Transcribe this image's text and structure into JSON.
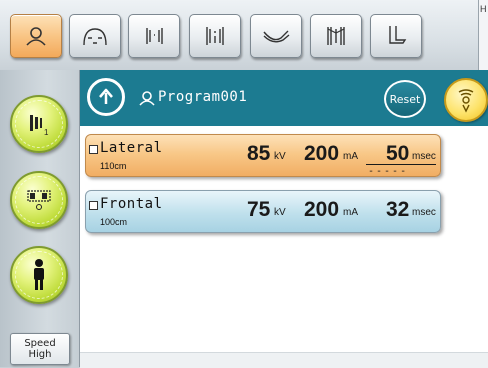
{
  "top_tabs": [
    {
      "icon": "head-icon",
      "active": true
    },
    {
      "icon": "skull-front-icon",
      "active": false
    },
    {
      "icon": "spine-icon",
      "active": false
    },
    {
      "icon": "ribcage-icon",
      "active": false
    },
    {
      "icon": "arm-icon",
      "active": false
    },
    {
      "icon": "pelvis-icon",
      "active": false
    },
    {
      "icon": "leg-icon",
      "active": false
    }
  ],
  "top_right": {
    "label": "H"
  },
  "sidebar": {
    "buttons": [
      {
        "icon": "detector-1-icon"
      },
      {
        "icon": "detector-grid-icon"
      },
      {
        "icon": "person-icon"
      }
    ],
    "speed": {
      "line1": "Speed",
      "line2": "High"
    }
  },
  "header": {
    "program_name": "Program001",
    "reset_label": "Reset"
  },
  "rows": [
    {
      "name": "Lateral",
      "distance": "110cm",
      "kv": "85",
      "kv_unit": "kV",
      "ma": "200",
      "ma_unit": "mA",
      "msec": "50",
      "msec_unit": "msec",
      "extra": "-----"
    },
    {
      "name": "Frontal",
      "distance": "100cm",
      "kv": "75",
      "kv_unit": "kV",
      "ma": "200",
      "ma_unit": "mA",
      "msec": "32",
      "msec_unit": "msec"
    }
  ]
}
